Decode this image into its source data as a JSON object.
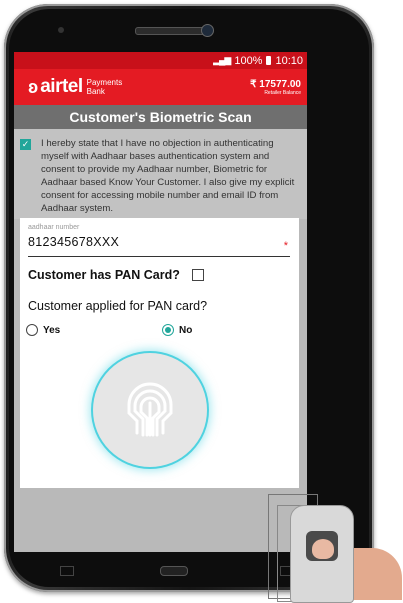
{
  "status_bar": {
    "battery": "100%",
    "time": "10:10"
  },
  "header": {
    "logo_text": "airtel",
    "logo_sub_line1": "Payments",
    "logo_sub_line2": "Bank",
    "balance": "₹ 17577.00",
    "balance_label": "Retailer Balance"
  },
  "title": "Customer's Biometric Scan",
  "consent": {
    "checked": true,
    "text": "I hereby state that I have no objection in authenticating myself with Aadhaar bases authentication system and consent to provide my Aadhaar number, Biometric for Aadhaar based Know Your Customer. I also give my explicit consent for accessing mobile number and email ID from Aadhaar system."
  },
  "form": {
    "aadhaar_placeholder": "aadhaar number",
    "aadhaar_value": "812345678XXX",
    "required_mark": "*",
    "pan_label": "Customer has PAN Card?",
    "pan_checked": false,
    "applied_label": "Customer applied for PAN card?",
    "options": [
      {
        "label": "Yes",
        "selected": false
      },
      {
        "label": "No",
        "selected": true
      }
    ]
  },
  "scanner": {
    "icon": "fingerprint-icon",
    "glow_color": "#4fd2e0"
  },
  "colors": {
    "brand": "#e41b23",
    "accent": "#21a69a",
    "title_bar": "#6f6f6f"
  }
}
